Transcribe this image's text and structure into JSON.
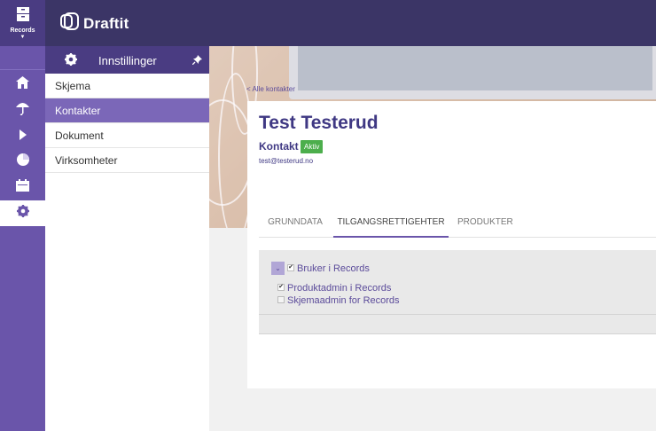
{
  "rail": {
    "records_label": "Records",
    "items": [
      {
        "icon": "home-icon"
      },
      {
        "icon": "umbrella-icon"
      },
      {
        "icon": "play-icon"
      },
      {
        "icon": "pie-chart-icon"
      },
      {
        "icon": "calendar-icon"
      },
      {
        "icon": "gear-icon"
      }
    ]
  },
  "header": {
    "brand": "Draftit"
  },
  "subnav": {
    "title": "Innstillinger",
    "items": [
      {
        "label": "Skjema"
      },
      {
        "label": "Kontakter"
      },
      {
        "label": "Dokument"
      },
      {
        "label": "Virksomheter"
      }
    ]
  },
  "contact": {
    "back_link": "< Alle kontakter",
    "name": "Test Testerud",
    "type": "Kontakt",
    "status": "Aktiv",
    "email": "test@testerud.no"
  },
  "tabs": [
    {
      "label": "GRUNNDATA"
    },
    {
      "label": "TILGANGSRETTIGEHTER"
    },
    {
      "label": "PRODUKTER"
    }
  ],
  "permissions": {
    "group_label": "Bruker i Records",
    "group_checked": true,
    "items": [
      {
        "label": "Produktadmin i Records",
        "checked": true
      },
      {
        "label": "Skjemaadmin for Records",
        "checked": false
      }
    ]
  },
  "colors": {
    "header": "#3b3566",
    "rail": "#6a55aa",
    "accent": "#7b67b8",
    "status_green": "#4cae4c",
    "title_text": "#3f3883"
  }
}
